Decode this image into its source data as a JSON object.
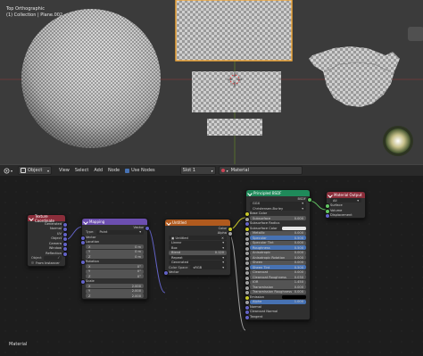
{
  "viewport": {
    "view_name": "Top Orthographic",
    "collection": "(1) Collection | Plane.002"
  },
  "header": {
    "editor_icon": "node-editor-icon",
    "mode": "Object",
    "menus": [
      "View",
      "Select",
      "Add",
      "Node"
    ],
    "use_nodes_label": "Use Nodes",
    "slot": "Slot 1",
    "material": "Material"
  },
  "nodes": {
    "texcoord": {
      "title": "Texture Coordinate",
      "color": "#8b2d3a",
      "outputs": [
        "Generated",
        "Normal",
        "UV",
        "Object",
        "Camera",
        "Window",
        "Reflection"
      ],
      "object_label": "Object",
      "from_instancer": "From Instancer"
    },
    "mapping": {
      "title": "Mapping",
      "color": "#6c4fb0",
      "output": "Vector",
      "type_label": "Type:",
      "type_value": "Point",
      "input_vector": "Vector",
      "location_label": "Location",
      "loc": [
        {
          "axis": "X",
          "val": "0 m"
        },
        {
          "axis": "Y",
          "val": "0 m"
        },
        {
          "axis": "Z",
          "val": "0 m"
        }
      ],
      "rotation_label": "Rotation",
      "rot": [
        {
          "axis": "X",
          "val": "0°"
        },
        {
          "axis": "Y",
          "val": "0°"
        },
        {
          "axis": "Z",
          "val": "0°"
        }
      ],
      "scale_label": "Scale",
      "scale": [
        {
          "axis": "X",
          "val": "2.000"
        },
        {
          "axis": "Y",
          "val": "2.000"
        },
        {
          "axis": "Z",
          "val": "2.000"
        }
      ]
    },
    "image": {
      "title": "Untitled",
      "color": "#b05a1e",
      "outputs": [
        "Color",
        "Alpha"
      ],
      "image_name": "Untitled",
      "interpolation": "Linear",
      "projection": "Box",
      "blend_label": "Blend",
      "blend_value": "0.120",
      "extension": "Repeat",
      "source": "Generated",
      "color_space_label": "Color Space",
      "color_space_value": "sRGB",
      "input_vector": "Vector"
    },
    "bsdf": {
      "title": "Principled BSDF",
      "color": "#1f8a5a",
      "output": "BSDF",
      "distribution": "GGX",
      "subsurface_method": "Christensen-Burley",
      "inputs": [
        {
          "label": "Base Color",
          "value": "",
          "kind": "plain"
        },
        {
          "label": "Subsurface",
          "value": "0.000",
          "kind": "field"
        },
        {
          "label": "Subsurface Radius",
          "value": "",
          "kind": "plain"
        },
        {
          "label": "Subsurface Color",
          "value": "",
          "kind": "white"
        },
        {
          "label": "Metallic",
          "value": "0.000",
          "kind": "field"
        },
        {
          "label": "Specular",
          "value": "0.500",
          "kind": "blue"
        },
        {
          "label": "Specular Tint",
          "value": "0.000",
          "kind": "field"
        },
        {
          "label": "Roughness",
          "value": "0.500",
          "kind": "blue"
        },
        {
          "label": "Anisotropic",
          "value": "0.000",
          "kind": "field"
        },
        {
          "label": "Anisotropic Rotation",
          "value": "0.000",
          "kind": "field"
        },
        {
          "label": "Sheen",
          "value": "0.000",
          "kind": "field"
        },
        {
          "label": "Sheen Tint",
          "value": "0.500",
          "kind": "blue"
        },
        {
          "label": "Clearcoat",
          "value": "0.000",
          "kind": "field"
        },
        {
          "label": "Clearcoat Roughness",
          "value": "0.030",
          "kind": "field"
        },
        {
          "label": "IOR",
          "value": "1.450",
          "kind": "field"
        },
        {
          "label": "Transmission",
          "value": "0.000",
          "kind": "field"
        },
        {
          "label": "Transmission Roughness",
          "value": "0.000",
          "kind": "field"
        },
        {
          "label": "Emission",
          "value": "",
          "kind": "black"
        },
        {
          "label": "Alpha",
          "value": "1.000",
          "kind": "blue"
        },
        {
          "label": "Normal",
          "value": "",
          "kind": "plain"
        },
        {
          "label": "Clearcoat Normal",
          "value": "",
          "kind": "plain"
        },
        {
          "label": "Tangent",
          "value": "",
          "kind": "plain"
        }
      ]
    },
    "output": {
      "title": "Material Output",
      "color": "#8b2d3a",
      "target": "All",
      "inputs": [
        "Surface",
        "Volume",
        "Displacement"
      ]
    }
  },
  "footer": {
    "label": "Material"
  },
  "socket_colors": {
    "vector": "#6363c7",
    "color": "#c7c729",
    "float": "#a1a1a1",
    "shader": "#63c763"
  }
}
